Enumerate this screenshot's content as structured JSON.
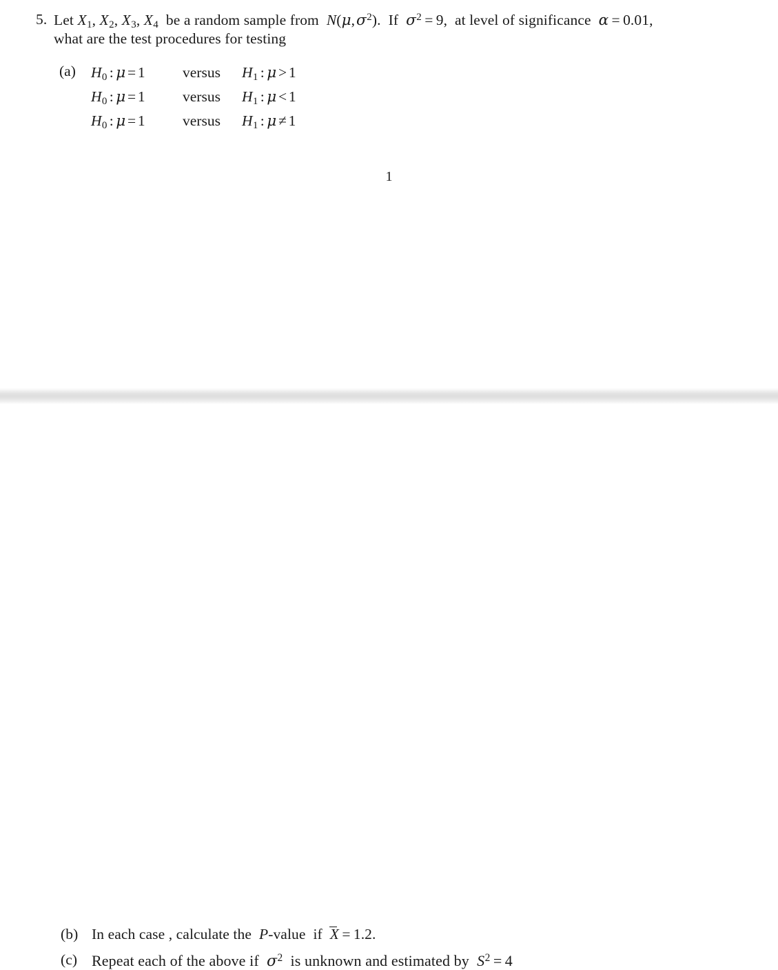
{
  "document": {
    "type": "math-homework-pdf",
    "page_folio": "1",
    "background_color": "#ffffff",
    "text_color": "#1a1a1a",
    "separator_color": "#dedede"
  },
  "problem": {
    "number": "5.",
    "line_1_prefix": "Let",
    "line_1_vars": "X",
    "line_1_text_a": "be a random sample from",
    "line_1_dist": "N",
    "line_1_text_b": "If",
    "line_1_sigma_value": "9",
    "line_1_text_c": ", at level of significance",
    "line_1_alpha_value": "0.01,",
    "line_2": "what are the test procedures for testing",
    "full_line_1": "Let X1, X2, X3, X4 be a random sample from N(μ, σ²). If σ² = 9, at level of significance α = 0.01,",
    "full_line_2": "what are the test procedures for testing"
  },
  "part_a": {
    "label": "(a)",
    "versus_label": "versus",
    "null_symbol": "H",
    "null_subscript": "0",
    "alt_symbol": "H",
    "alt_subscript": "1",
    "mu_symbol": "μ",
    "rows": [
      {
        "null_relation": "=",
        "null_value": "1",
        "versus": "versus",
        "alt_relation": ">",
        "alt_value": "1",
        "text": "H0 : μ = 1   versus   H1 : μ > 1"
      },
      {
        "null_relation": "=",
        "null_value": "1",
        "versus": "versus",
        "alt_relation": "<",
        "alt_value": "1",
        "text": "H0 : μ = 1   versus   H1 : μ < 1"
      },
      {
        "null_relation": "=",
        "null_value": "1",
        "versus": "versus",
        "alt_relation": "≠",
        "alt_value": "1",
        "text": "H0 : μ = 1   versus   H1 : μ ≠ 1"
      }
    ]
  },
  "part_b": {
    "label": "(b)",
    "text_a": "In each case , calculate the",
    "p_value_symbol": "P",
    "text_b": "-value if",
    "xbar_symbol": "X",
    "xbar_value": "1.2.",
    "full_text": "In each case , calculate the P-value if X̄ = 1.2."
  },
  "part_c": {
    "label": "(c)",
    "text_a": "Repeat each of the above if",
    "sigma_symbol": "σ",
    "text_b": "is unknown and estimated by",
    "s_symbol": "S",
    "s_value": "4",
    "full_text": "Repeat each of the above if σ² is unknown and estimated by S² = 4"
  }
}
